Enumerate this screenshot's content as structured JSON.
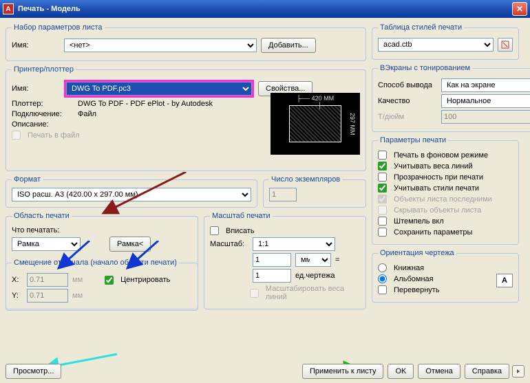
{
  "window": {
    "title": "Печать - Модель"
  },
  "pageSetup": {
    "legend": "Набор параметров листа",
    "name_label": "Имя:",
    "name_value": "<нет>",
    "add_btn": "Добавить..."
  },
  "printer": {
    "legend": "Принтер/плоттер",
    "name_label": "Имя:",
    "name_value": "DWG To PDF.pc3",
    "properties_btn": "Свойства...",
    "plotter_label": "Плоттер:",
    "plotter_value": "DWG To PDF - PDF ePlot - by Autodesk",
    "connection_label": "Подключение:",
    "connection_value": "Файл",
    "description_label": "Описание:",
    "print_to_file": "Печать в файл",
    "preview_w": "420 MM",
    "preview_h": "297 MM"
  },
  "format": {
    "legend": "Формат",
    "value": "ISO расш. A3 (420.00 x 297.00 мм)"
  },
  "copies": {
    "legend": "Число экземпляров",
    "value": "1"
  },
  "area": {
    "legend": "Область печати",
    "what_label": "Что печатать:",
    "value": "Рамка",
    "frame_btn": "Рамка<"
  },
  "scale": {
    "legend": "Масштаб печати",
    "fit": "Вписать",
    "scale_label": "Масштаб:",
    "ratio": "1:1",
    "v1": "1",
    "unit": "мм",
    "eq": "=",
    "v2": "1",
    "drawing_units": "ед.чертежа",
    "scale_lineweights": "Масштабировать веса линий"
  },
  "offset": {
    "legend": "Смещение от начала (начало области печати)",
    "x_label": "X:",
    "x_value": "0.71",
    "y_label": "Y:",
    "y_value": "0.71",
    "unit": "мм",
    "center": "Центрировать"
  },
  "styles": {
    "legend": "Таблица стилей печати",
    "value": "acad.ctb"
  },
  "shaded": {
    "legend": "ВЭкраны с тонированием",
    "mode_label": "Способ вывода",
    "mode_value": "Как на экране",
    "quality_label": "Качество",
    "quality_value": "Нормальное",
    "dpi_label": "Т/дюйм",
    "dpi_value": "100"
  },
  "options": {
    "legend": "Параметры печати",
    "bg": "Печать в фоновом режиме",
    "lw": "Учитывать веса линий",
    "transp": "Прозрачность при печати",
    "styles_on": "Учитывать стили печати",
    "paperspace_last": "Объекты листа последними",
    "hide_paperspace": "Скрывать объекты листа",
    "stamp": "Штемпель вкл",
    "save": "Сохранить параметры"
  },
  "orient": {
    "legend": "Ориентация чертежа",
    "portrait": "Книжная",
    "landscape": "Альбомная",
    "upside": "Перевернуть",
    "icon": "A"
  },
  "buttons": {
    "preview": "Просмотр...",
    "apply": "Применить к листу",
    "ok": "OK",
    "cancel": "Отмена",
    "help": "Справка"
  }
}
